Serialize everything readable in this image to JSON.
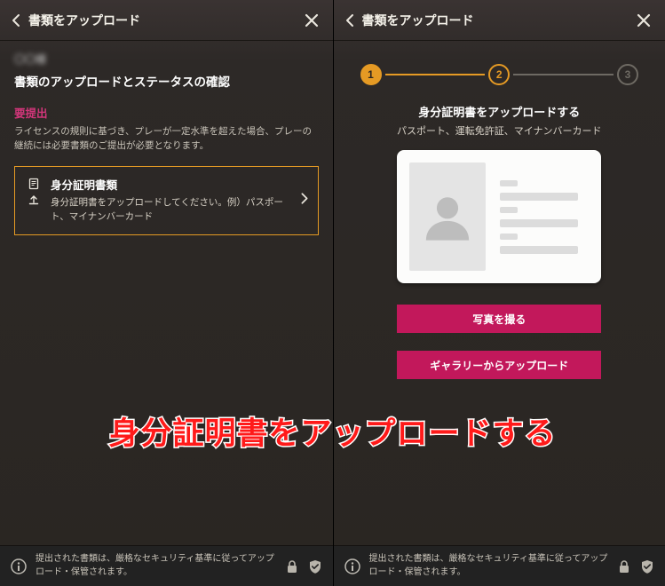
{
  "header": {
    "title": "書類をアップロード"
  },
  "left": {
    "username": "〇〇様",
    "heading": "書類のアップロードとステータスの確認",
    "requiredLabel": "要提出",
    "requiredNote": "ライセンスの規則に基づき、プレーが一定水準を超えた場合、プレーの継続には必要書類のご提出が必要となります。",
    "card": {
      "title": "身分証明書類",
      "desc": "身分証明書をアップロードしてください。例）パスポート、マイナンバーカード"
    }
  },
  "right": {
    "steps": [
      "1",
      "2",
      "3"
    ],
    "title": "身分証明書をアップロードする",
    "subtitle": "パスポート、運転免許証、マイナンバーカード",
    "takePhoto": "写真を撮る",
    "fromGallery": "ギャラリーからアップロード"
  },
  "footer": {
    "text": "提出された書類は、厳格なセキュリティ基準に従ってアップロード・保管されます。"
  },
  "overlayText": "身分証明書をアップロードする",
  "colors": {
    "accent": "#e59a24",
    "danger": "#c2185b",
    "requiredLabel": "#d2367a",
    "primaryBtn": "#c2185b"
  }
}
